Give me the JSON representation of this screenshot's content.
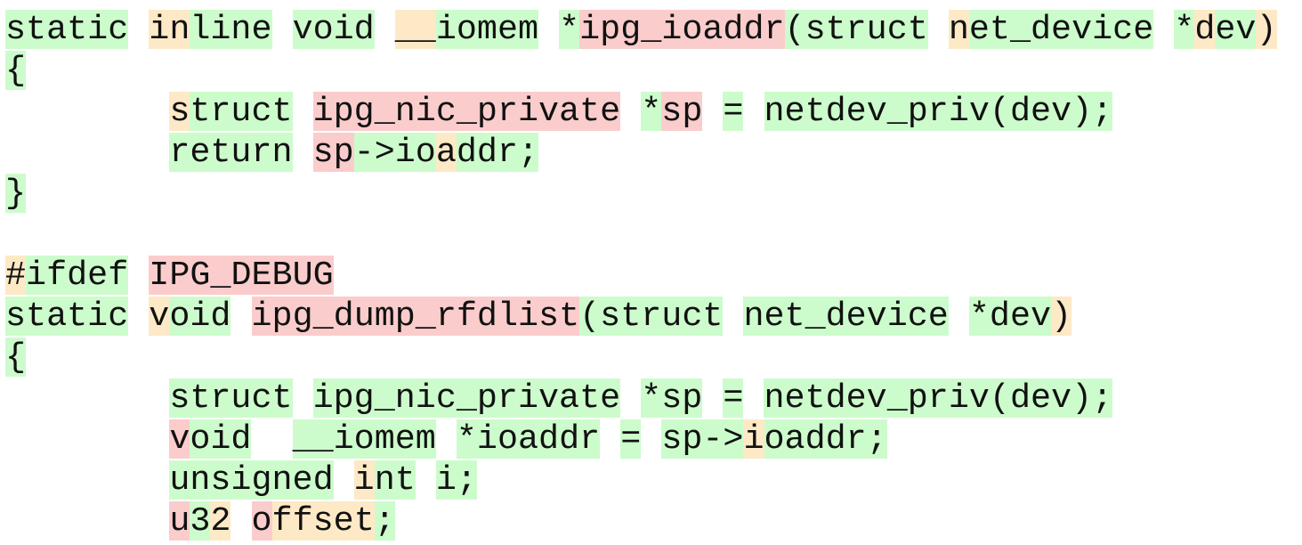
{
  "palette": {
    "match": "#ccfccc",
    "mismatch": "#fbcccc",
    "partial": "#fde9c6"
  },
  "lines": [
    [
      [
        "g",
        "static"
      ],
      [
        "w",
        " "
      ],
      [
        "y",
        "in"
      ],
      [
        "g",
        "line"
      ],
      [
        "w",
        " "
      ],
      [
        "g",
        "void"
      ],
      [
        "w",
        " "
      ],
      [
        "y",
        "__"
      ],
      [
        "g",
        "iomem"
      ],
      [
        "w",
        " "
      ],
      [
        "g",
        "*"
      ],
      [
        "r",
        "ipg_ioaddr"
      ],
      [
        "g",
        "(struct"
      ],
      [
        "w",
        " "
      ],
      [
        "y",
        "n"
      ],
      [
        "g",
        "et_device"
      ],
      [
        "w",
        " "
      ],
      [
        "g",
        "*"
      ],
      [
        "y",
        "d"
      ],
      [
        "g",
        "ev"
      ],
      [
        "y",
        ")"
      ]
    ],
    [
      [
        "g",
        "{"
      ]
    ],
    [
      [
        "w",
        "        "
      ],
      [
        "y",
        "s"
      ],
      [
        "g",
        "truct"
      ],
      [
        "w",
        " "
      ],
      [
        "r",
        "ipg_nic_private"
      ],
      [
        "w",
        " "
      ],
      [
        "g",
        "*"
      ],
      [
        "r",
        "sp"
      ],
      [
        "w",
        " "
      ],
      [
        "g",
        "="
      ],
      [
        "w",
        " "
      ],
      [
        "g",
        "netdev_priv(dev);"
      ]
    ],
    [
      [
        "w",
        "        "
      ],
      [
        "g",
        "return"
      ],
      [
        "w",
        " "
      ],
      [
        "r",
        "sp"
      ],
      [
        "g",
        "->io"
      ],
      [
        "y",
        "a"
      ],
      [
        "g",
        "ddr;"
      ]
    ],
    [
      [
        "g",
        "}"
      ]
    ],
    [],
    [
      [
        "y",
        "#"
      ],
      [
        "g",
        "ifdef"
      ],
      [
        "w",
        " "
      ],
      [
        "r",
        "IPG_DEBUG"
      ]
    ],
    [
      [
        "g",
        "static"
      ],
      [
        "w",
        " "
      ],
      [
        "y",
        "v"
      ],
      [
        "g",
        "oid"
      ],
      [
        "w",
        " "
      ],
      [
        "r",
        "ipg_dump_rfdlist"
      ],
      [
        "g",
        "(struct"
      ],
      [
        "w",
        " "
      ],
      [
        "g",
        "net_device"
      ],
      [
        "w",
        " "
      ],
      [
        "g",
        "*dev"
      ],
      [
        "y",
        ")"
      ]
    ],
    [
      [
        "g",
        "{"
      ]
    ],
    [
      [
        "w",
        "        "
      ],
      [
        "g",
        "struct"
      ],
      [
        "w",
        " "
      ],
      [
        "g",
        "ipg_nic_private"
      ],
      [
        "w",
        " "
      ],
      [
        "g",
        "*sp"
      ],
      [
        "w",
        " "
      ],
      [
        "g",
        "="
      ],
      [
        "w",
        " "
      ],
      [
        "g",
        "netdev_priv(dev);"
      ]
    ],
    [
      [
        "w",
        "        "
      ],
      [
        "r",
        "v"
      ],
      [
        "g",
        "oid"
      ],
      [
        "w",
        "  "
      ],
      [
        "g",
        "__iomem"
      ],
      [
        "w",
        " "
      ],
      [
        "g",
        "*ioaddr"
      ],
      [
        "w",
        " "
      ],
      [
        "g",
        "="
      ],
      [
        "w",
        " "
      ],
      [
        "g",
        "sp->"
      ],
      [
        "y",
        "i"
      ],
      [
        "g",
        "oaddr;"
      ]
    ],
    [
      [
        "w",
        "        "
      ],
      [
        "g",
        "unsigned"
      ],
      [
        "w",
        " "
      ],
      [
        "y",
        "i"
      ],
      [
        "g",
        "nt"
      ],
      [
        "w",
        " "
      ],
      [
        "g",
        "i;"
      ]
    ],
    [
      [
        "w",
        "        "
      ],
      [
        "r",
        "u"
      ],
      [
        "g",
        "3"
      ],
      [
        "y",
        "2"
      ],
      [
        "w",
        " "
      ],
      [
        "r",
        "o"
      ],
      [
        "y",
        "ffset"
      ],
      [
        "g",
        ";"
      ]
    ]
  ]
}
